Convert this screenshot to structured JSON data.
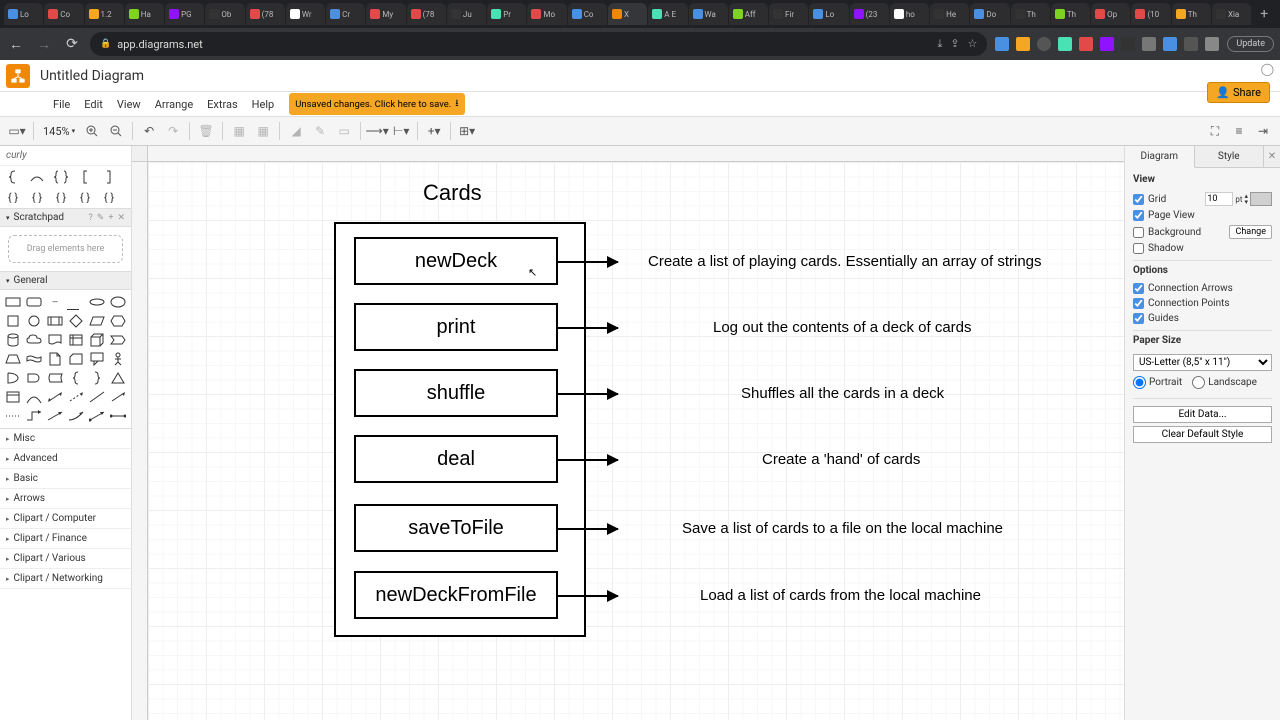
{
  "browser": {
    "tabs": [
      "Lo",
      "Co",
      "1.2",
      "Ha",
      "PG",
      "Ob",
      "(78",
      "Wr",
      "Cr",
      "My",
      "(78",
      "Ju",
      "Pr",
      "Mo",
      "Co",
      "X",
      "A E",
      "Wa",
      "Aff",
      "Fir",
      "Lo",
      "(23",
      "ho",
      "He",
      "Do",
      "Th",
      "Th",
      "Op",
      "(10",
      "Th",
      "Xia"
    ],
    "url": "app.diagrams.net",
    "update": "Update"
  },
  "app": {
    "title": "Untitled Diagram",
    "share": "Share",
    "menu": [
      "File",
      "Edit",
      "View",
      "Arrange",
      "Extras",
      "Help"
    ],
    "unsaved": "Unsaved changes. Click here to save."
  },
  "toolbar": {
    "zoom": "145%"
  },
  "sidebar": {
    "search": "curly",
    "scratchpad": "Scratchpad",
    "scratchpad_hint": "Drag elements here",
    "general": "General",
    "categories": [
      "Misc",
      "Advanced",
      "Basic",
      "Arrows",
      "Clipart / Computer",
      "Clipart / Finance",
      "Clipart / Various",
      "Clipart / Networking"
    ]
  },
  "diagram": {
    "title": "Cards",
    "methods": [
      {
        "name": "newDeck",
        "desc": "Create a list of playing cards. Essentially an array of strings"
      },
      {
        "name": "print",
        "desc": "Log out the contents of a deck of cards"
      },
      {
        "name": "shuffle",
        "desc": "Shuffles all the cards in a deck"
      },
      {
        "name": "deal",
        "desc": "Create a 'hand' of cards"
      },
      {
        "name": "saveToFile",
        "desc": "Save a list of cards to a file on the local machine"
      },
      {
        "name": "newDeckFromFile",
        "desc": "Load a list of cards from the local machine"
      }
    ]
  },
  "format": {
    "tabs": [
      "Diagram",
      "Style"
    ],
    "view": "View",
    "grid": "Grid",
    "grid_size": "10",
    "grid_unit": "pt",
    "page_view": "Page View",
    "background": "Background",
    "change": "Change",
    "shadow": "Shadow",
    "options": "Options",
    "conn_arrows": "Connection Arrows",
    "conn_points": "Connection Points",
    "guides": "Guides",
    "paper_size": "Paper Size",
    "paper_value": "US-Letter (8,5\" x 11\")",
    "portrait": "Portrait",
    "landscape": "Landscape",
    "edit_data": "Edit Data...",
    "clear_style": "Clear Default Style"
  }
}
